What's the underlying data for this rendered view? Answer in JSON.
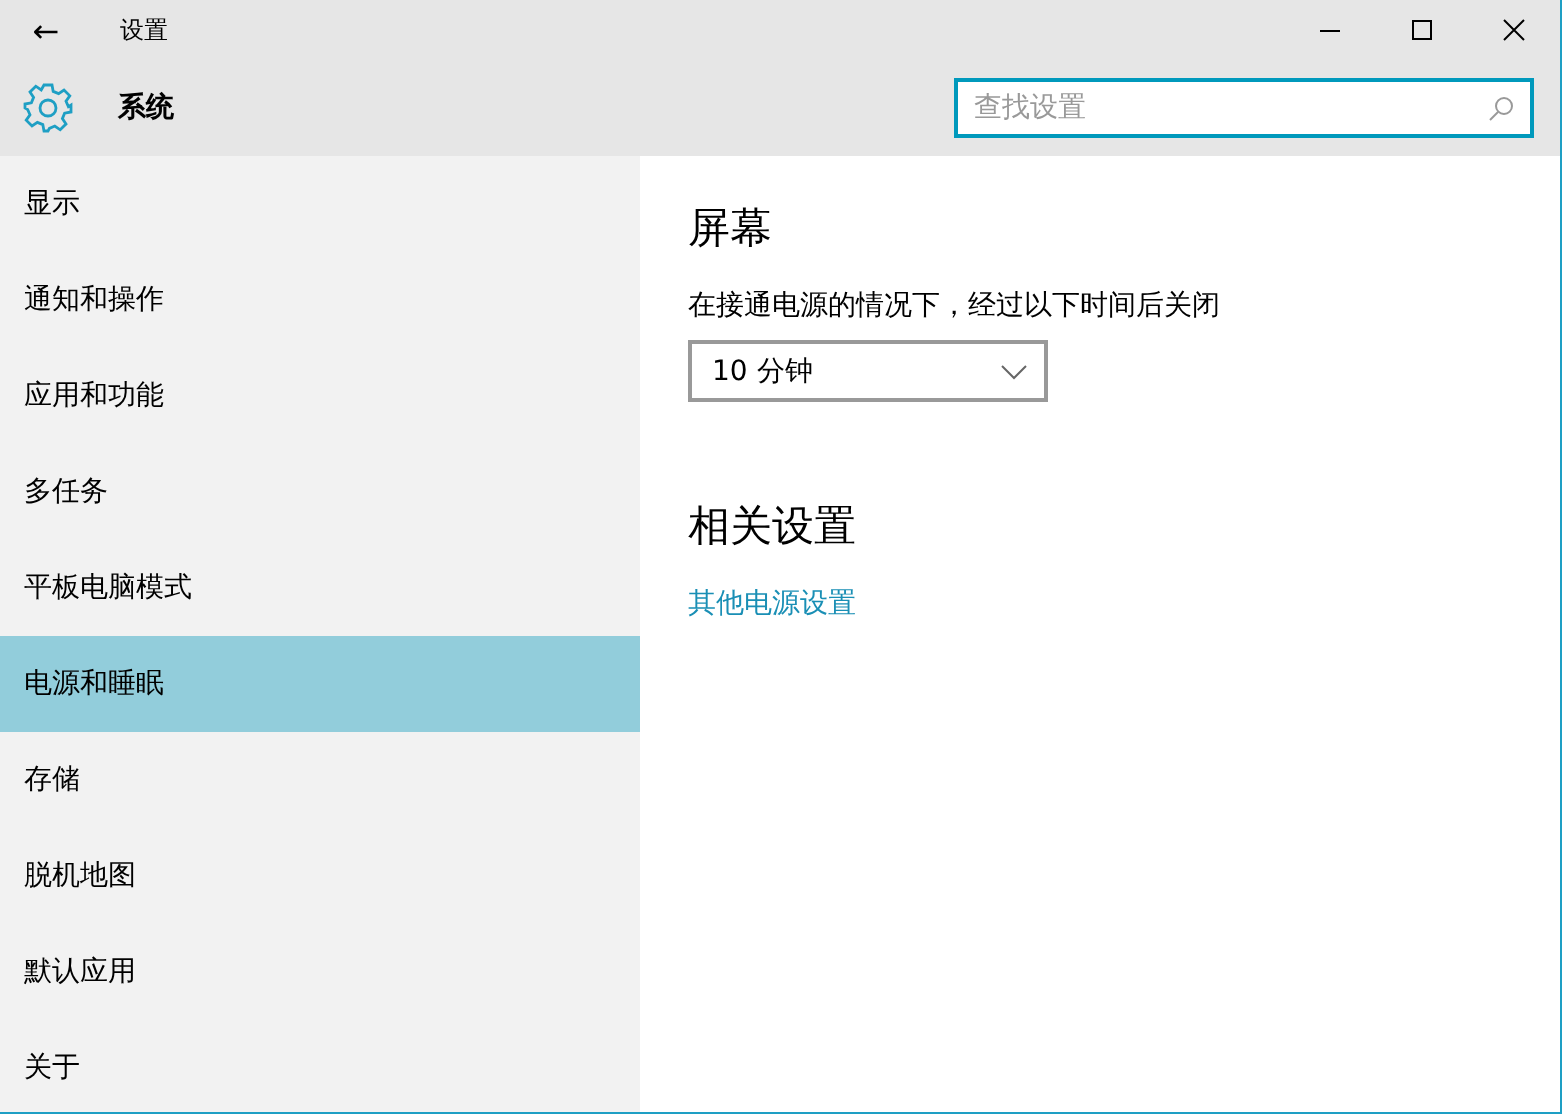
{
  "window": {
    "title": "设置",
    "back": "←"
  },
  "header": {
    "title": "系统"
  },
  "search": {
    "placeholder": "查找设置"
  },
  "sidebar": {
    "items": [
      {
        "label": "显示",
        "selected": false
      },
      {
        "label": "通知和操作",
        "selected": false
      },
      {
        "label": "应用和功能",
        "selected": false
      },
      {
        "label": "多任务",
        "selected": false
      },
      {
        "label": "平板电脑模式",
        "selected": false
      },
      {
        "label": "电源和睡眠",
        "selected": true
      },
      {
        "label": "存储",
        "selected": false
      },
      {
        "label": "脱机地图",
        "selected": false
      },
      {
        "label": "默认应用",
        "selected": false
      },
      {
        "label": "关于",
        "selected": false
      }
    ]
  },
  "content": {
    "screen_heading": "屏幕",
    "screen_label": "在接通电源的情况下，经过以下时间后关闭",
    "screen_value": "10 分钟",
    "related_heading": "相关设置",
    "related_link": "其他电源设置"
  }
}
